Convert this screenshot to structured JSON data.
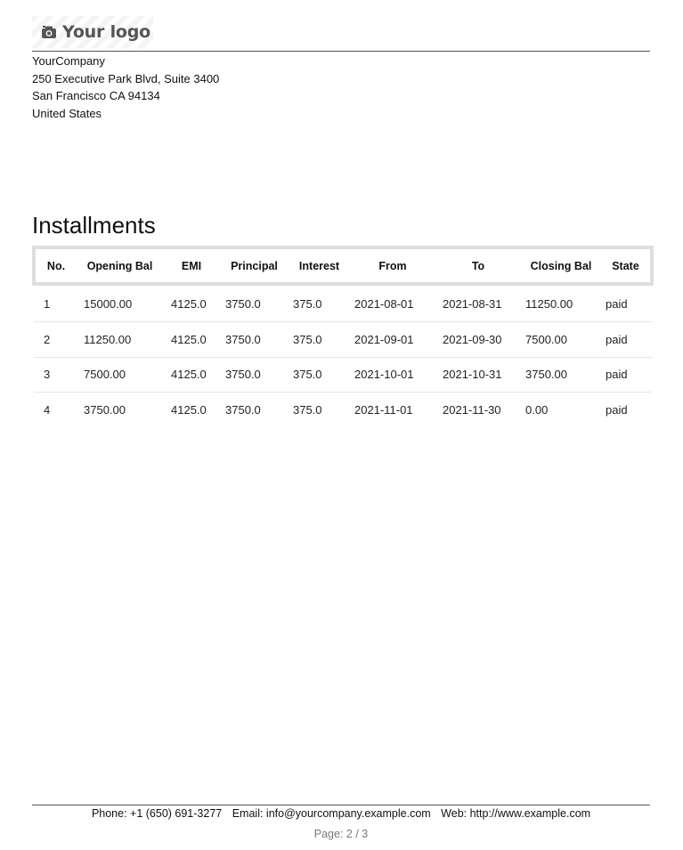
{
  "logo": {
    "text": "Your logo",
    "icon": "camera-icon"
  },
  "company": {
    "name": "YourCompany",
    "street": "250 Executive Park Blvd, Suite 3400",
    "city_line": "San Francisco CA 94134",
    "country": "United States"
  },
  "section_title": "Installments",
  "table": {
    "headers": [
      "No.",
      "Opening Bal",
      "EMI",
      "Principal",
      "Interest",
      "From",
      "To",
      "Closing Bal",
      "State"
    ],
    "rows": [
      [
        "1",
        "15000.00",
        "4125.0",
        "3750.0",
        "375.0",
        "2021-08-01",
        "2021-08-31",
        "11250.00",
        "paid"
      ],
      [
        "2",
        "11250.00",
        "4125.0",
        "3750.0",
        "375.0",
        "2021-09-01",
        "2021-09-30",
        "7500.00",
        "paid"
      ],
      [
        "3",
        "7500.00",
        "4125.0",
        "3750.0",
        "375.0",
        "2021-10-01",
        "2021-10-31",
        "3750.00",
        "paid"
      ],
      [
        "4",
        "3750.00",
        "4125.0",
        "3750.0",
        "375.0",
        "2021-11-01",
        "2021-11-30",
        "0.00",
        "paid"
      ]
    ]
  },
  "footer": {
    "phone": "Phone: +1 (650) 691-3277",
    "email": "Email: info@yourcompany.example.com",
    "web": "Web: http://www.example.com",
    "page": "Page: 2 / 3"
  },
  "colors": {
    "text": "#111111",
    "rule": "#555555",
    "header_border": "#dedede",
    "row_divider": "#e6e6e6",
    "page_number": "#777777"
  }
}
